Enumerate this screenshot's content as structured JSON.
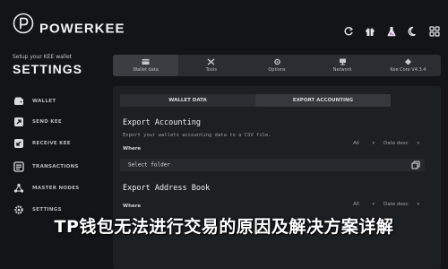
{
  "header": {
    "brand": "POWERKEE",
    "icons": [
      "refresh-icon",
      "gift-icon",
      "flask-icon",
      "moon-icon",
      "grid-icon"
    ]
  },
  "sidebar": {
    "subtitle": "Setup your KEE wallet",
    "title": "SETTINGS",
    "items": [
      {
        "label": "WALLET",
        "icon": "wallet-icon"
      },
      {
        "label": "SEND KEE",
        "icon": "send-icon"
      },
      {
        "label": "RECEIVE KEE",
        "icon": "receive-icon"
      },
      {
        "label": "TRANSACTIONS",
        "icon": "list-icon"
      },
      {
        "label": "MASTER NODES",
        "icon": "nodes-icon"
      },
      {
        "label": "SETTINGS",
        "icon": "gear-icon"
      }
    ]
  },
  "top_tabs": [
    {
      "label": "Wallet data",
      "icon": "wallet-data-icon",
      "active": true
    },
    {
      "label": "Tools",
      "icon": "tools-icon",
      "active": false
    },
    {
      "label": "Options",
      "icon": "options-icon",
      "active": false
    },
    {
      "label": "Network",
      "icon": "network-icon",
      "active": false
    },
    {
      "label": "Kee Core V4.3.4",
      "icon": "kee-core-icon",
      "active": false
    }
  ],
  "sub_tabs": [
    {
      "label": "WALLET DATA",
      "active": false
    },
    {
      "label": "EXPORT ACCOUNTING",
      "active": true
    }
  ],
  "export_accounting": {
    "title": "Export Accounting",
    "description": "Export your wallets accounting data to a CSV file.",
    "where_label": "Where",
    "filter_all": "All",
    "filter_date": "Date desc",
    "folder_placeholder": "Select folder"
  },
  "export_address_book": {
    "title": "Export Address Book",
    "where_label": "Where",
    "filter_all": "All",
    "filter_date": "Date desc"
  },
  "overlay": {
    "banner": "TP钱包无法进行交易的原因及解决方案详解"
  },
  "colors": {
    "background": "#121417",
    "panel": "#1d2023",
    "accent_text": "#eef0f2"
  }
}
